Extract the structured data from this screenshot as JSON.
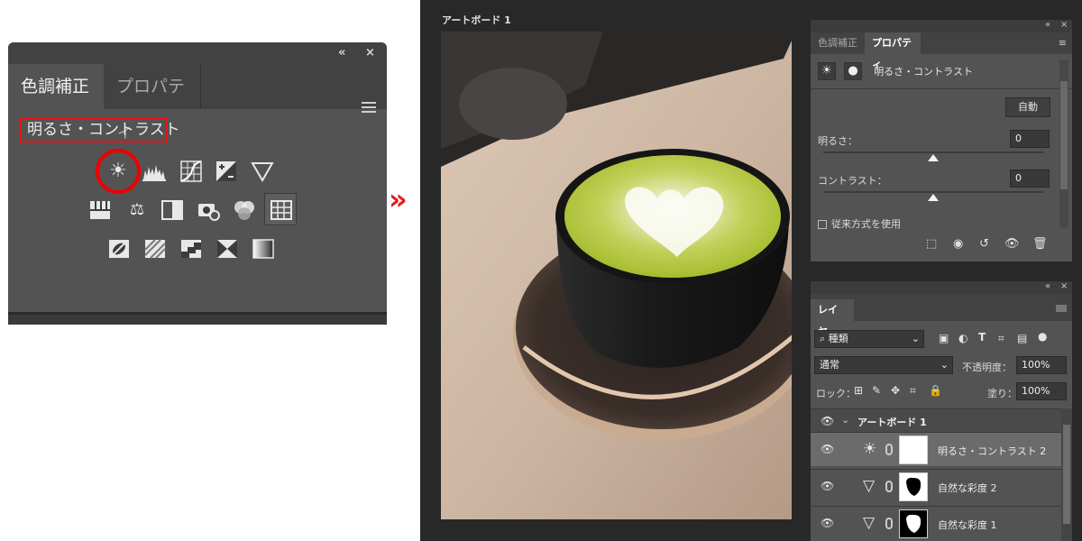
{
  "adjustments_panel": {
    "collapse_icon": "«",
    "close_icon": "×",
    "tab_adjustments": "色調補正",
    "tab_properties": "プロパティ",
    "menu_icon": "hamburger-menu-icon",
    "hint_label": "明るさ・コントラスト",
    "icons_row1": [
      "brightness-contrast-icon",
      "levels-icon",
      "curves-icon",
      "exposure-icon",
      "vibrance-icon"
    ],
    "icons_row2": [
      "hue-saturation-icon",
      "color-balance-icon",
      "black-white-icon",
      "photo-filter-icon",
      "channel-mixer-icon",
      "color-lookup-icon"
    ],
    "icons_row3": [
      "invert-icon",
      "posterize-icon",
      "threshold-icon",
      "selective-color-icon",
      "gradient-map-icon"
    ],
    "highlight_color": "#e00000"
  },
  "arrow": "»",
  "workspace": {
    "artboard_title": "アートボード 1",
    "properties": {
      "tab_inactive": "色調補正",
      "tab_active": "プロパティ",
      "layer_type": "明るさ・コントラスト",
      "auto_button": "自動",
      "brightness_label": "明るさ：",
      "brightness_value": "0",
      "contrast_label": "コントラスト：",
      "contrast_value": "0",
      "legacy_checkbox": "従来方式を使用",
      "brightness_slider": 0.5,
      "contrast_slider": 0.5
    },
    "layers": {
      "tab": "レイヤー",
      "filter_kind": "種類",
      "blend_mode": "通常",
      "opacity_label": "不透明度：",
      "opacity_value": "100%",
      "lock_label": "ロック：",
      "fill_label": "塗り：",
      "fill_value": "100%",
      "group_name": "アートボード 1",
      "rows": [
        {
          "name": "明るさ・コントラスト 2",
          "selected": true
        },
        {
          "name": "自然な彩度 2",
          "selected": false
        },
        {
          "name": "自然な彩度 1",
          "selected": false
        }
      ]
    }
  }
}
